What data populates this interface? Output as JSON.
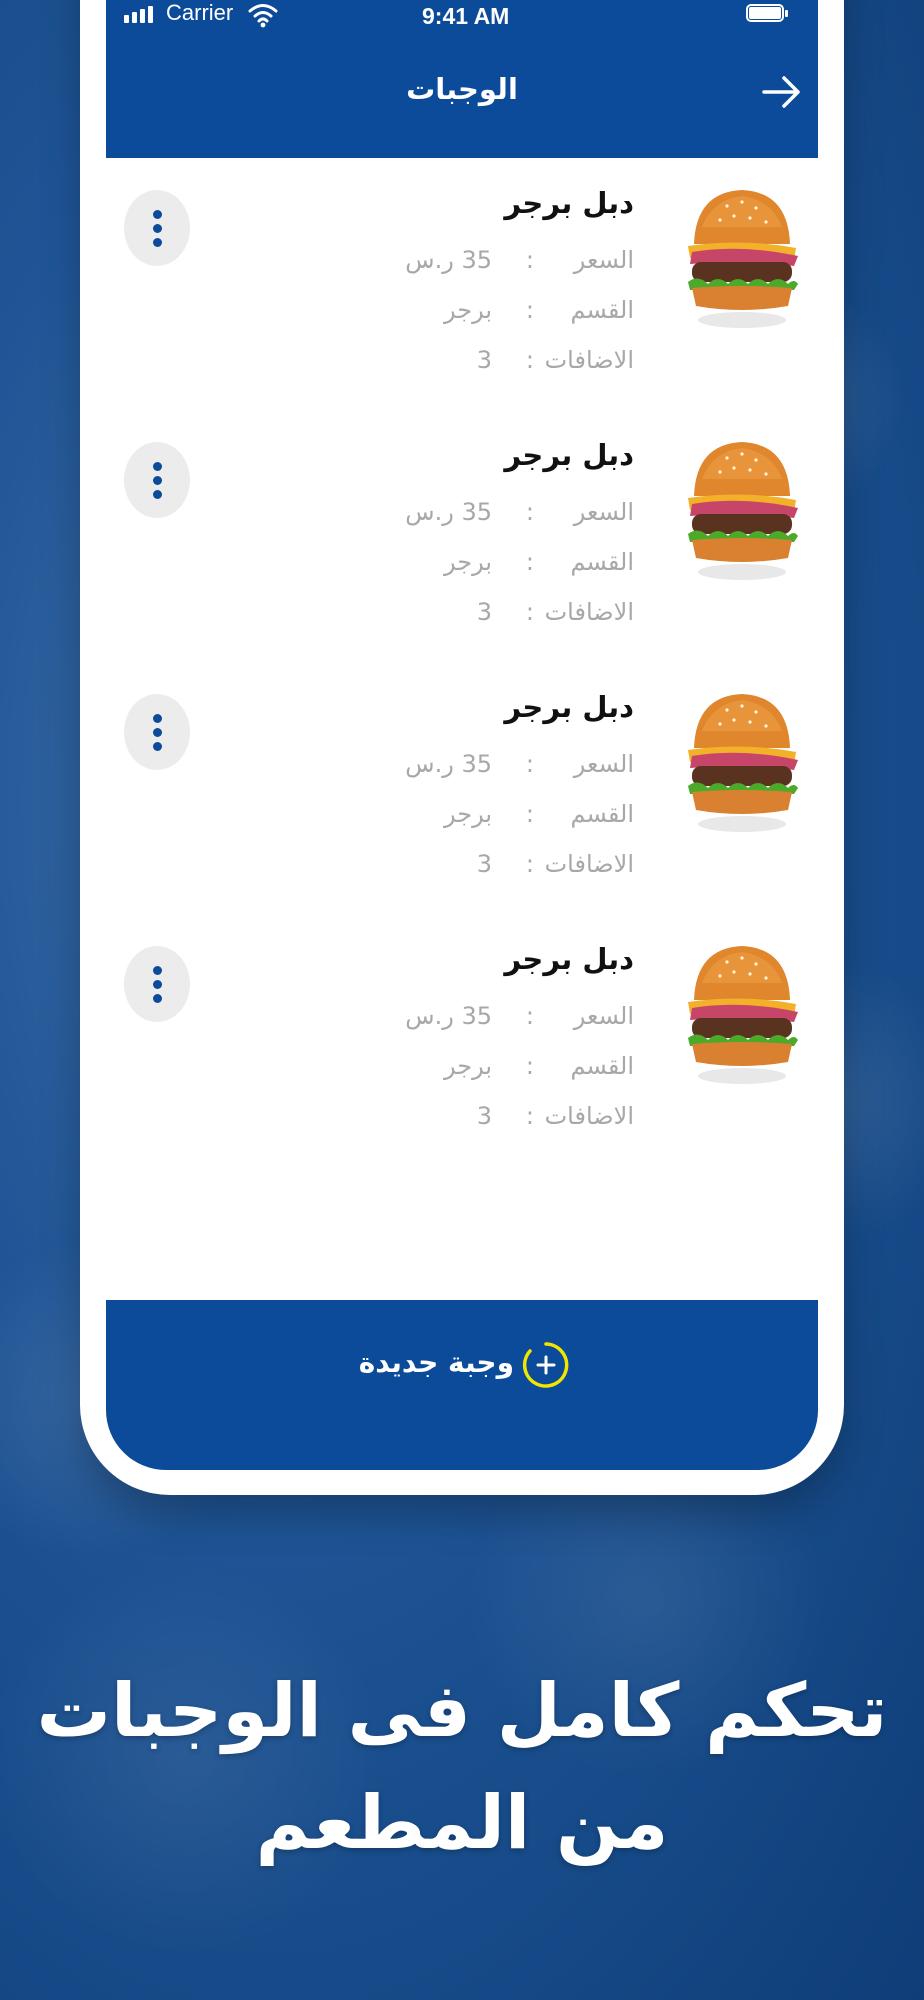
{
  "status_bar": {
    "carrier": "Carrier",
    "time": "9:41 AM"
  },
  "header": {
    "title": "الوجبات",
    "back_icon": "arrow-right-icon"
  },
  "labels": {
    "price": "السعر",
    "category": "القسم",
    "addons": "الاضافات",
    "colon": ":"
  },
  "meals": [
    {
      "name": "دبل برجر",
      "price": "35 ر.س",
      "category": "برجر",
      "addons": "3"
    },
    {
      "name": "دبل برجر",
      "price": "35 ر.س",
      "category": "برجر",
      "addons": "3"
    },
    {
      "name": "دبل برجر",
      "price": "35 ر.س",
      "category": "برجر",
      "addons": "3"
    },
    {
      "name": "دبل برجر",
      "price": "35 ر.س",
      "category": "برجر",
      "addons": "3"
    }
  ],
  "add_button": {
    "label": "وجبة جديدة",
    "icon": "plus-circle-icon"
  },
  "promo": {
    "line1": "تحكم كامل فى الوجبات",
    "line2": "من المطعم"
  },
  "colors": {
    "primary": "#0b4b99",
    "accent": "#f2e600"
  }
}
